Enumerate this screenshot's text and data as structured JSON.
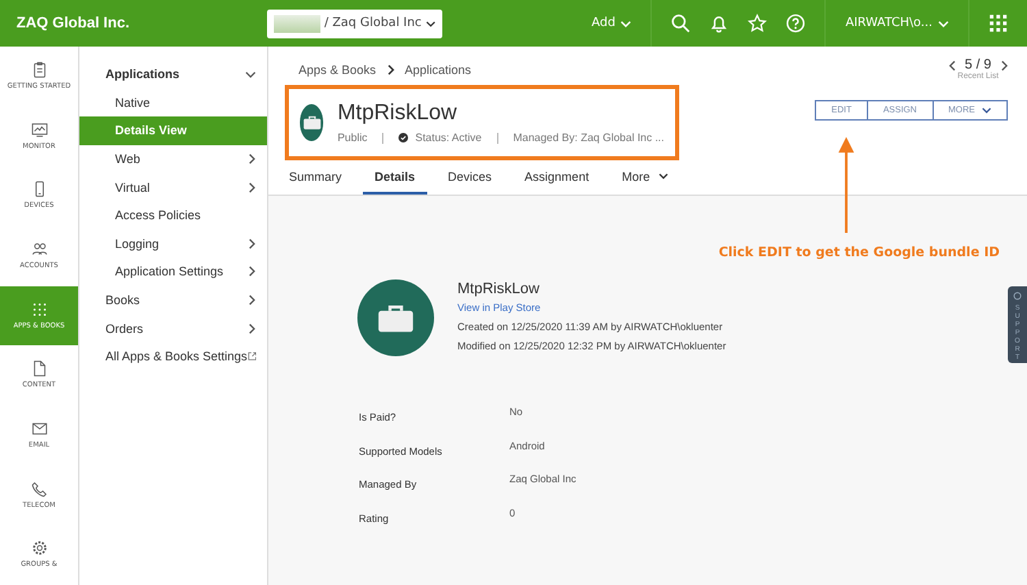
{
  "top_bar": {
    "brand": "ZAQ Global Inc.",
    "org_selector": "/ Zaq Global Inc",
    "add": "Add",
    "user": "AIRWATCH\\o..."
  },
  "rail": [
    {
      "label": "GETTING STARTED",
      "selected": false
    },
    {
      "label": "MONITOR",
      "selected": false
    },
    {
      "label": "DEVICES",
      "selected": false
    },
    {
      "label": "ACCOUNTS",
      "selected": false
    },
    {
      "label": "APPS & BOOKS",
      "selected": true
    },
    {
      "label": "CONTENT",
      "selected": false
    },
    {
      "label": "EMAIL",
      "selected": false
    },
    {
      "label": "TELECOM",
      "selected": false
    },
    {
      "label": "GROUPS &",
      "selected": false
    }
  ],
  "nav": [
    {
      "label": "Applications",
      "kind": "section",
      "expanded": true,
      "selected": false,
      "children": [
        {
          "label": "Native",
          "kind": "item",
          "selected": false
        },
        {
          "label": "Details View",
          "kind": "item",
          "selected": true
        },
        {
          "label": "Web",
          "kind": "more",
          "selected": false
        },
        {
          "label": "Virtual",
          "kind": "more",
          "selected": false
        },
        {
          "label": "Access Policies",
          "kind": "item",
          "selected": false
        },
        {
          "label": "Logging",
          "kind": "more",
          "selected": false
        },
        {
          "label": "Application Settings",
          "kind": "more",
          "selected": false
        }
      ]
    },
    {
      "label": "Books",
      "kind": "more",
      "selected": false
    },
    {
      "label": "Orders",
      "kind": "more",
      "selected": false
    },
    {
      "label": "All Apps & Books Settings",
      "kind": "external",
      "selected": false
    }
  ],
  "breadcrumb": [
    "Apps & Books",
    "Applications"
  ],
  "pager": {
    "position": "5 / 9",
    "caption": "Recent List"
  },
  "app_header": {
    "name": "MtpRiskLow",
    "visibility": "Public",
    "status": "Status: Active",
    "managed_by": "Managed By: Zaq Global Inc ..."
  },
  "actions": [
    {
      "label": "EDIT",
      "kind": "plain"
    },
    {
      "label": "ASSIGN",
      "kind": "plain"
    },
    {
      "label": "MORE",
      "kind": "menu"
    }
  ],
  "tabs": [
    {
      "label": "Summary",
      "selected": false,
      "kind": "plain"
    },
    {
      "label": "Details",
      "selected": true,
      "kind": "plain"
    },
    {
      "label": "Devices",
      "selected": false,
      "kind": "plain"
    },
    {
      "label": "Assignment",
      "selected": false,
      "kind": "plain"
    },
    {
      "label": "More",
      "selected": false,
      "kind": "menu"
    }
  ],
  "annotation": "Click EDIT to get the Google bundle ID",
  "support_tab": "SUPPORT",
  "app_card": {
    "name": "MtpRiskLow",
    "link": "View in Play Store",
    "created": "Created on 12/25/2020 11:39 AM by AIRWATCH\\okluenter",
    "modified": "Modified on 12/25/2020 12:32 PM by AIRWATCH\\okluenter"
  },
  "details": [
    {
      "label": "Is Paid?",
      "value": "No"
    },
    {
      "label": "Supported Models",
      "value": "Android"
    },
    {
      "label": "Managed By",
      "value": "Zaq Global Inc"
    },
    {
      "label": "Rating",
      "value": "0"
    }
  ]
}
